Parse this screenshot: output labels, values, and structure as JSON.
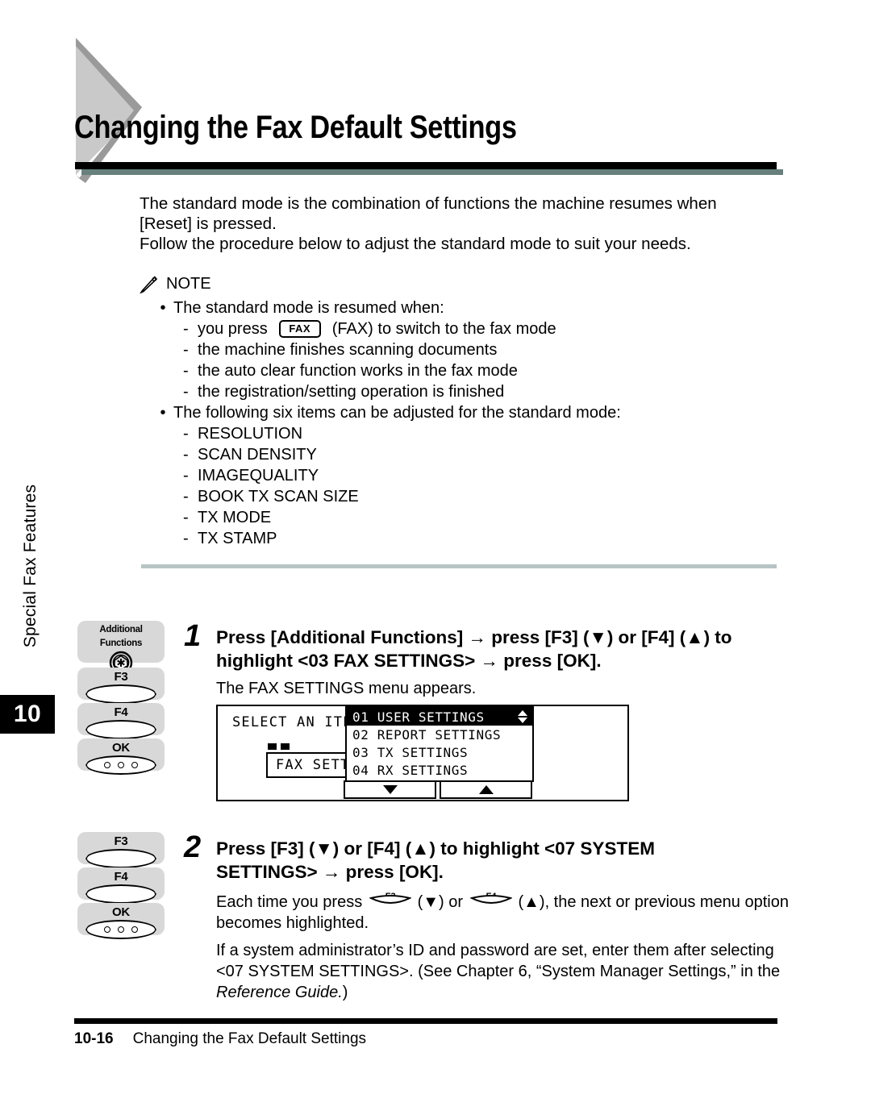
{
  "page": {
    "title": "Changing the Fax Default Settings",
    "chapter_label": "Special Fax Features",
    "chapter_number": "10"
  },
  "intro": {
    "line1": "The standard mode is the combination of functions the machine resumes when",
    "line2": "[Reset] is pressed.",
    "line3": "Follow the procedure below to adjust the standard mode to suit your needs."
  },
  "note": {
    "icon": "pencil-icon",
    "heading": "NOTE",
    "bullet1": "The standard mode is resumed when:",
    "sub1_pre": "you press",
    "sub1_key": "FAX",
    "sub1_post": "(FAX) to switch to the fax mode",
    "sub2": "the machine finishes scanning documents",
    "sub3": "the auto clear function works in the fax mode",
    "sub4": "the registration/setting operation is finished",
    "bullet2": "The following six items can be adjusted for the standard mode:",
    "items": [
      "RESOLUTION",
      "SCAN DENSITY",
      "IMAGEQUALITY",
      "BOOK TX SCAN SIZE",
      "TX MODE",
      "TX STAMP"
    ]
  },
  "step1": {
    "number": "1",
    "title_line1": "Press [Additional Functions] → press [F3] (▼) or [F4] (▲) to",
    "title_line2": "highlight <03 FAX SETTINGS> → press [OK].",
    "body": "The FAX SETTINGS menu appears.",
    "keys": [
      {
        "label": "Additional Functions",
        "glyph": "additional-functions-icon"
      },
      {
        "label": "F3",
        "glyph": "oval-key"
      },
      {
        "label": "F4",
        "glyph": "oval-key"
      },
      {
        "label": "OK",
        "glyph": "oval-key-dots"
      }
    ]
  },
  "lcd": {
    "select_label": "SELECT AN ITEM",
    "field_value": "FAX SETTINGS",
    "menu": [
      {
        "text": "01 USER SETTINGS",
        "selected": true
      },
      {
        "text": "02 REPORT SETTINGS",
        "selected": false
      },
      {
        "text": "03 TX SETTINGS",
        "selected": false
      },
      {
        "text": "04 RX SETTINGS",
        "selected": false
      }
    ],
    "button_down": "down-arrow-icon",
    "button_up": "up-arrow-icon"
  },
  "step2": {
    "number": "2",
    "title_line1": "Press [F3] (▼) or [F4] (▲) to highlight <07 SYSTEM",
    "title_line2": "SETTINGS> → press [OK].",
    "body_pre": "Each time you press",
    "body_key1": "F3",
    "body_mid1": "(▼) or",
    "body_key2": "F4",
    "body_mid2": "(▲), the next or previous menu option",
    "body_line2": "becomes highlighted.",
    "note_line1": "If a system administrator’s ID and password are set, enter them after selecting",
    "note_line2": "<07 SYSTEM SETTINGS>. (See Chapter 6, “System Manager Settings,” in the",
    "note_line3_italic": "Reference Guide.",
    "note_line3_tail": ")",
    "keys": [
      {
        "label": "F3",
        "glyph": "oval-key"
      },
      {
        "label": "F4",
        "glyph": "oval-key"
      },
      {
        "label": "OK",
        "glyph": "oval-key-dots"
      }
    ]
  },
  "footer": {
    "page_number": "10-16",
    "running_title": "Changing the Fax Default Settings"
  },
  "colors": {
    "rule_black": "#000000",
    "rule_shadow": "#67807d",
    "divider": "#b6c4c4",
    "key_block": "#d8d8d8",
    "triangle_light": "#c9c9c9",
    "triangle_dark": "#9a9a9a"
  }
}
